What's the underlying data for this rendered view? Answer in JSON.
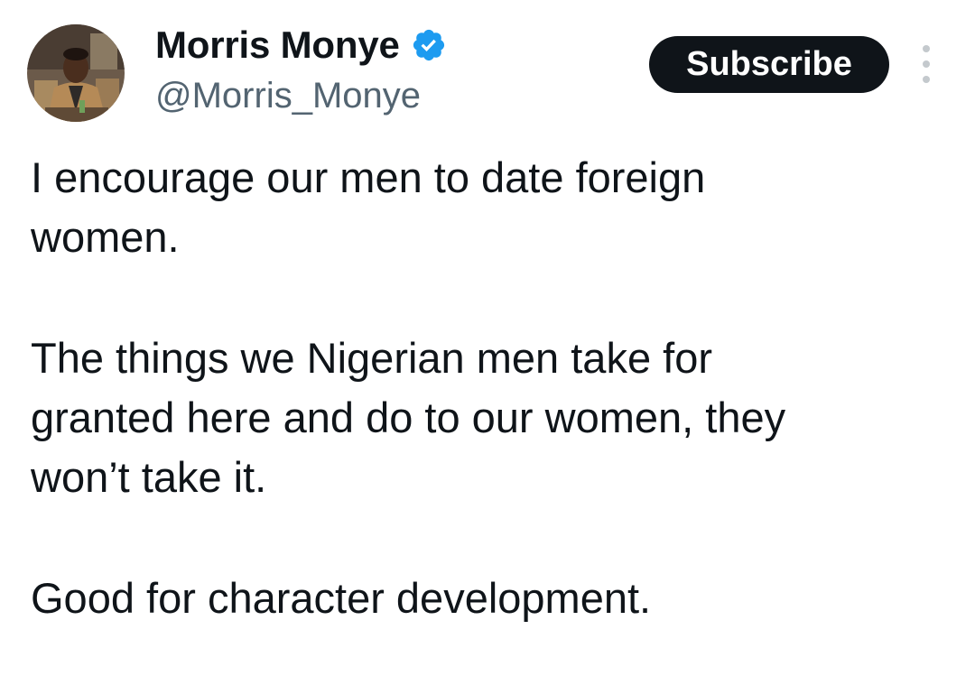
{
  "author": {
    "display_name": "Morris Monye",
    "handle": "@Morris_Monye",
    "verified": true,
    "avatar_icon": "profile-photo"
  },
  "actions": {
    "subscribe_label": "Subscribe",
    "more_icon": "more-vertical-icon"
  },
  "tweet": {
    "paragraphs": [
      [
        "I encourage our men to date foreign",
        "women."
      ],
      [
        "The things we Nigerian men take for",
        "granted here and do to our women, they",
        "won’t take it."
      ],
      [
        "Good for character development."
      ]
    ]
  },
  "colors": {
    "verified_badge": "#1d9bf0",
    "subscribe_bg": "#0f1419",
    "handle": "#536471"
  }
}
